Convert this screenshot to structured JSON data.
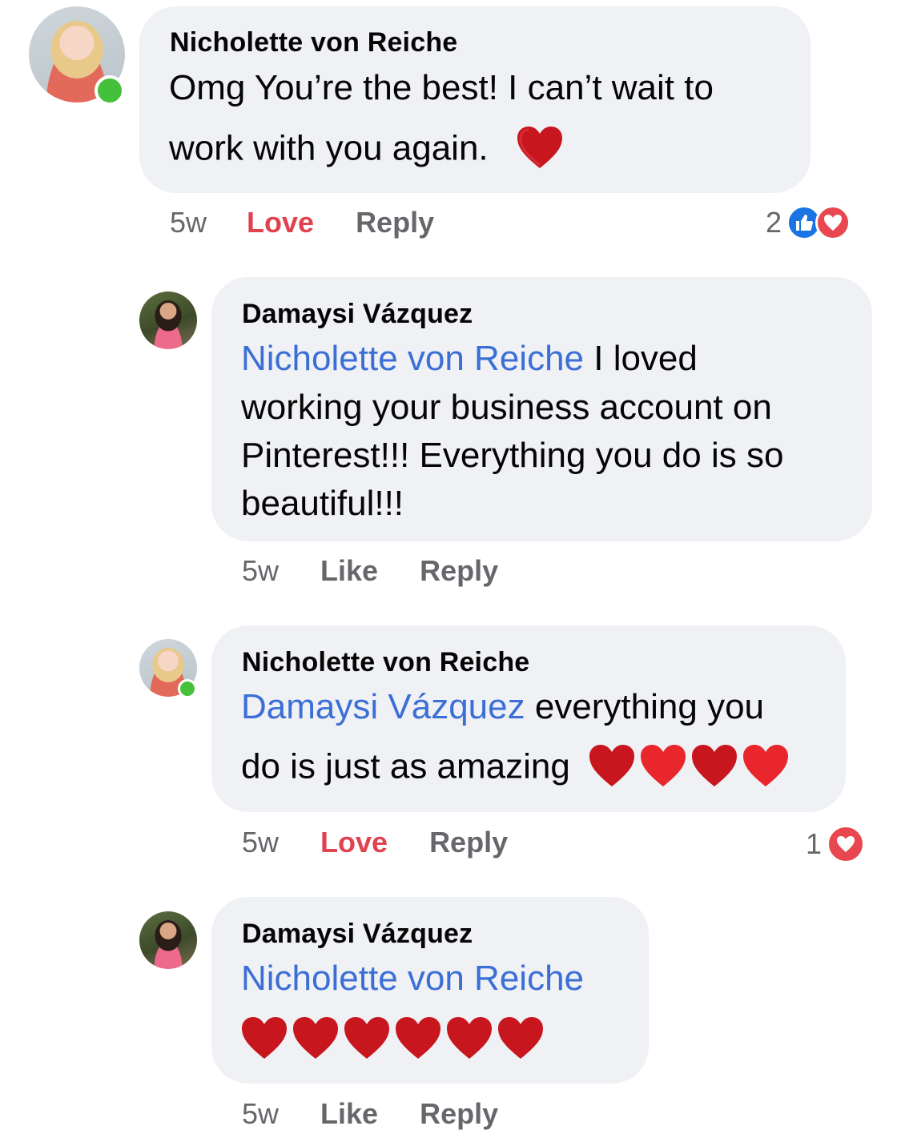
{
  "comments": [
    {
      "author": "Nicholette von Reiche",
      "line1": "Omg You’re the best! I can’t wait to",
      "line2": "work with you again.",
      "time": "5w",
      "action_primary": "Love",
      "action_reply": "Reply",
      "reaction_count": "2",
      "reaction_icons": [
        "like-icon",
        "love-icon"
      ],
      "online": true
    },
    {
      "author": "Damaysi Vázquez",
      "mention": "Nicholette von Reiche",
      "line1_rest": " I loved",
      "line2": "working your business account on",
      "line3": "Pinterest!!! Everything you do is so",
      "line4": "beautiful!!!",
      "time": "5w",
      "action_primary": "Like",
      "action_reply": "Reply"
    },
    {
      "author": "Nicholette von Reiche",
      "mention": "Damaysi Vázquez",
      "line1_rest": " everything you",
      "line2": "do is just as amazing",
      "time": "5w",
      "action_primary": "Love",
      "action_reply": "Reply",
      "reaction_count": "1",
      "reaction_icons": [
        "love-icon"
      ],
      "online": true
    },
    {
      "author": "Damaysi Vázquez",
      "mention": "Nicholette von Reiche",
      "time": "5w",
      "action_primary": "Like",
      "action_reply": "Reply"
    }
  ],
  "colors": {
    "bubble": "#f0f1f5",
    "mention": "#3b6fd6",
    "love": "#e0424f",
    "meta": "#65676b",
    "online": "#44c03a"
  }
}
